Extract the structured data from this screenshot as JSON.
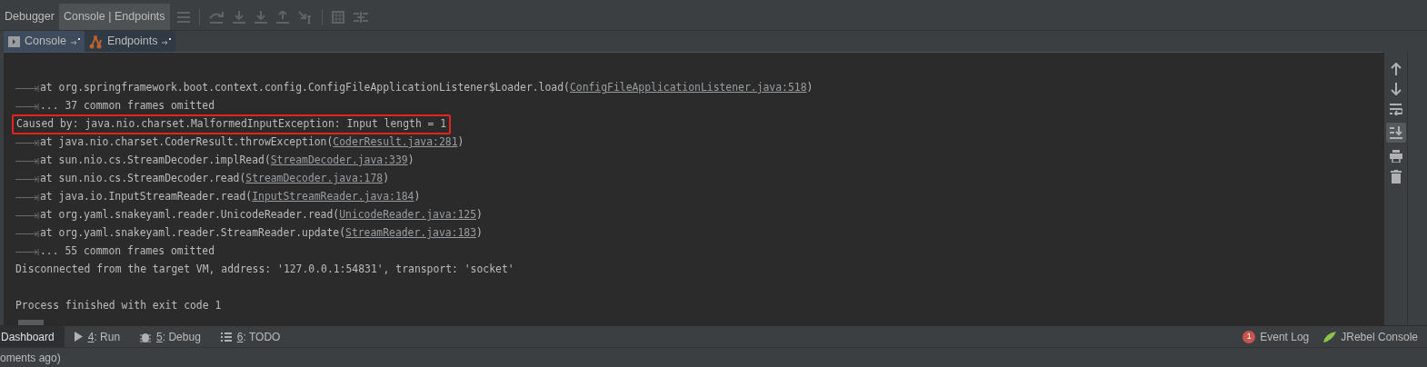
{
  "top_tabs": [
    {
      "label": "Debugger",
      "selected": false
    },
    {
      "label": "Console | Endpoints",
      "selected": true
    }
  ],
  "sub_tabs": [
    {
      "label": "Console",
      "kind": "console",
      "selected": true
    },
    {
      "label": "Endpoints",
      "kind": "endpoints",
      "selected": false
    }
  ],
  "console_lines": [
    {
      "kind": "frame",
      "text": "at org.springframework.boot.context.config.ConfigFileApplicationListener$Loader.load(",
      "link": "ConfigFileApplicationListener.java:518",
      "after": ")"
    },
    {
      "kind": "omitted",
      "text": "... 37 common frames omitted"
    },
    {
      "kind": "caused",
      "text": "Caused by: java.nio.charset.MalformedInputException: Input length = 1",
      "highlighted": true
    },
    {
      "kind": "frame",
      "text": "at java.nio.charset.CoderResult.throwException(",
      "link": "CoderResult.java:281",
      "after": ")"
    },
    {
      "kind": "frame",
      "text": "at sun.nio.cs.StreamDecoder.implRead(",
      "link": "StreamDecoder.java:339",
      "after": ")"
    },
    {
      "kind": "frame",
      "text": "at sun.nio.cs.StreamDecoder.read(",
      "link": "StreamDecoder.java:178",
      "after": ")"
    },
    {
      "kind": "frame",
      "text": "at java.io.InputStreamReader.read(",
      "link": "InputStreamReader.java:184",
      "after": ")"
    },
    {
      "kind": "frame",
      "text": "at org.yaml.snakeyaml.reader.UnicodeReader.read(",
      "link": "UnicodeReader.java:125",
      "after": ")"
    },
    {
      "kind": "frame",
      "text": "at org.yaml.snakeyaml.reader.StreamReader.update(",
      "link": "StreamReader.java:183",
      "after": ")"
    },
    {
      "kind": "omitted",
      "text": "... 55 common frames omitted"
    },
    {
      "kind": "plain",
      "text": "Disconnected from the target VM, address: '127.0.0.1:54831', transport: 'socket'"
    },
    {
      "kind": "blank"
    },
    {
      "kind": "plain",
      "text": "Process finished with exit code 1"
    }
  ],
  "tool_windows": [
    {
      "label": "Dashboard",
      "selected": true,
      "kind": "plain"
    },
    {
      "number": "4",
      "label": ": Run",
      "selected": false,
      "kind": "run"
    },
    {
      "number": "5",
      "label": ": Debug",
      "selected": false,
      "kind": "debug"
    },
    {
      "number": "6",
      "label": ": TODO",
      "selected": false,
      "kind": "todo"
    }
  ],
  "right_tool_windows": [
    {
      "label": "Event Log",
      "badge": "1",
      "kind": "event"
    },
    {
      "label": "JRebel Console",
      "kind": "jrebel"
    }
  ],
  "status_bar": {
    "text": "oments ago)"
  }
}
